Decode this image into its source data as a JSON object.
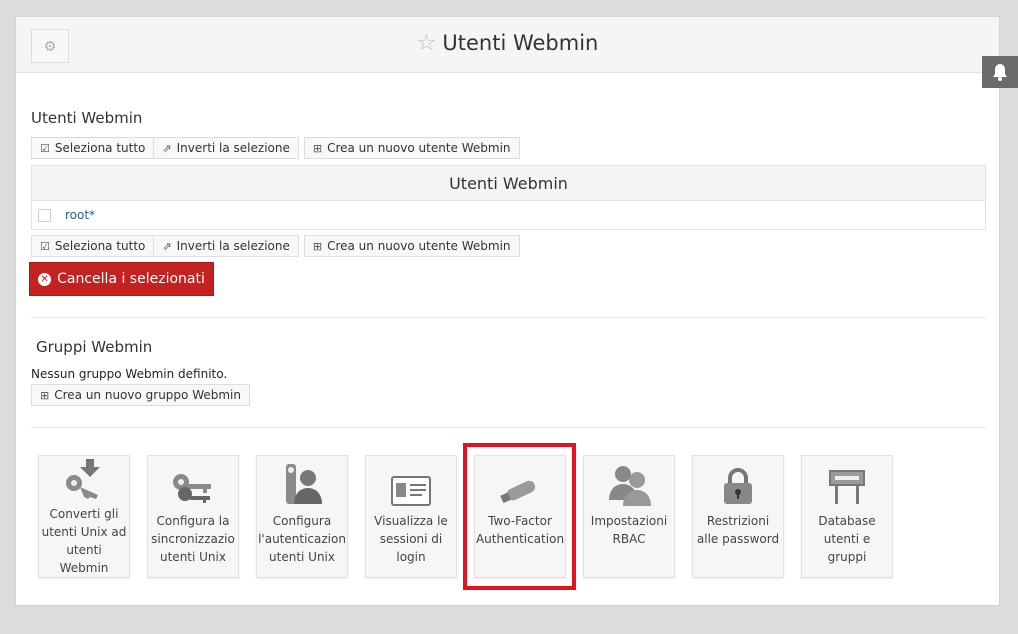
{
  "header": {
    "title": "Utenti Webmin"
  },
  "users_section": {
    "title": "Utenti Webmin",
    "select_all": "Seleziona tutto",
    "invert_selection": "Inverti la selezione",
    "create_user": "Crea un nuovo utente Webmin",
    "table_title": "Utenti Webmin",
    "rows": [
      {
        "name": "root*"
      }
    ],
    "delete_selected": "Cancella i selezionati"
  },
  "groups_section": {
    "title": "Gruppi Webmin",
    "empty_note": "Nessun gruppo Webmin definito.",
    "create_group": "Crea un nuovo gruppo Webmin"
  },
  "tiles": [
    {
      "icon": "convert-users-icon",
      "label": "Converti gli\nutenti Unix ad\nutenti Webmin"
    },
    {
      "icon": "keys-icon",
      "label": "Configura la\nsincronizzazio\nutenti Unix"
    },
    {
      "icon": "auth-keys-icon",
      "label": "Configura\nl'autenticazion\nutenti Unix"
    },
    {
      "icon": "id-card-icon",
      "label": "Visualizza le\nsessioni di\nlogin"
    },
    {
      "icon": "usb-key-icon",
      "label": "Two-Factor\nAuthentication"
    },
    {
      "icon": "users-group-icon",
      "label": "Impostazioni\nRBAC"
    },
    {
      "icon": "padlock-icon",
      "label": "Restrizioni\nalle password"
    },
    {
      "icon": "mysql-sign-icon",
      "label": "Database\nutenti e gruppi"
    }
  ],
  "colors": {
    "danger": "#c42121",
    "highlight": "#e3121f",
    "link": "#2a5d93"
  }
}
